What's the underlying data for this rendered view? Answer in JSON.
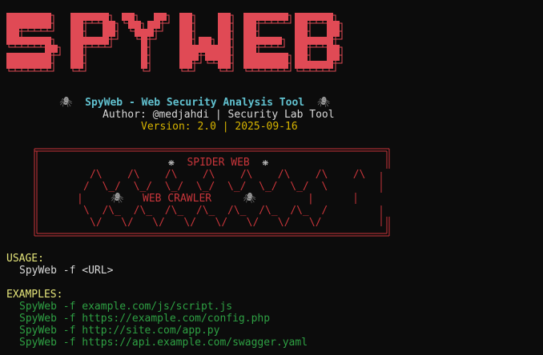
{
  "banner": {
    "text": "SPYWEB",
    "color": "#e04a55"
  },
  "header": {
    "title_icon": "spider-icon",
    "title": "SpyWeb - Web Security Analysis Tool",
    "author": "Author: @medjahdi | Security Lab Tool",
    "version": "Version: 2.0 | 2025-09-16"
  },
  "spider_box": {
    "heading": "SPIDER WEB",
    "heading_icon": "cobweb-icon",
    "crawler_label": "WEB CRAWLER",
    "crawler_icon": "spider-icon",
    "row1": "/\\    /\\    /\\    /\\    /\\    /\\    /\\    /\\",
    "row2": "/  \\_/  \\_/  \\_/  \\_/  \\_/  \\_/  \\_/  \\",
    "row3_left": "|",
    "row3_mid": "|",
    "row3_right": "|",
    "row4": "\\  /\\_  /\\_  /\\_  /\\_  /\\_  /\\_  /\\_  /",
    "row5": "\\/   \\/   \\/   \\/   \\/   \\/   \\/   \\/",
    "colors": {
      "border": "#c8353a",
      "text": "#c8353a"
    }
  },
  "usage": {
    "title": "USAGE:",
    "command": "SpyWeb -f <URL>"
  },
  "examples": {
    "title": "EXAMPLES:",
    "items": [
      "SpyWeb -f example.com/js/script.js",
      "SpyWeb -f https://example.com/config.php",
      "SpyWeb -f http://site.com/app.py",
      "SpyWeb -f https://api.example.com/swagger.yaml"
    ]
  },
  "colors": {
    "background": "#0c0c0c",
    "cyan": "#61c1cf",
    "yellow": "#d7b400",
    "green": "#2ea043",
    "usage_label": "#e5e57a"
  }
}
